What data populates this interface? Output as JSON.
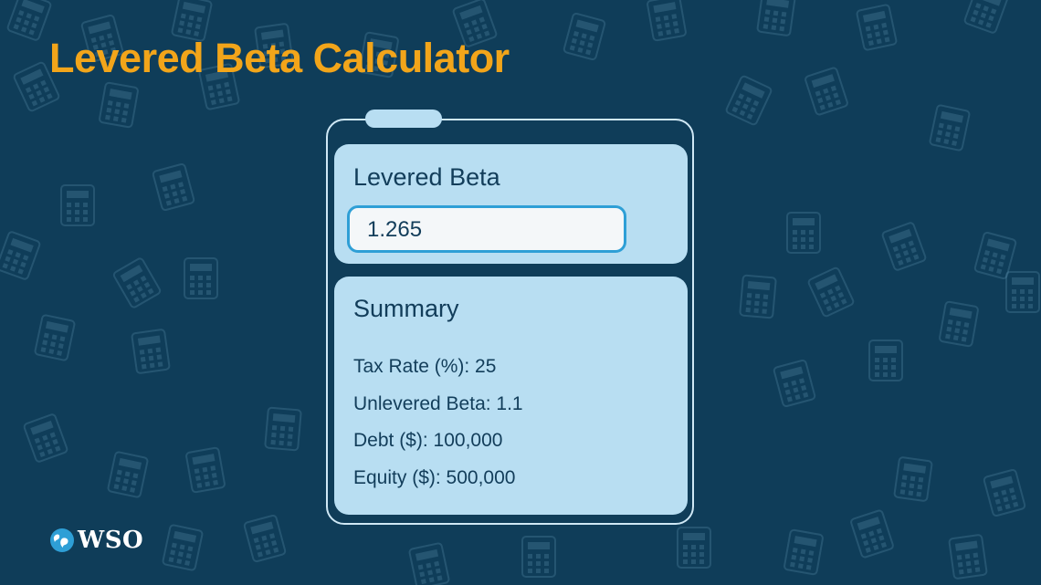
{
  "page": {
    "title": "Levered Beta Calculator",
    "title_color": "#f2a51a",
    "background_color": "#0f3d59"
  },
  "result_card": {
    "heading": "Levered Beta",
    "value": "1.265"
  },
  "summary_card": {
    "heading": "Summary",
    "items": [
      "Tax Rate (%): 25",
      "Unlevered Beta: 1.1",
      "Debt ($): 100,000",
      "Equity ($): 500,000"
    ]
  },
  "brand": {
    "name": "WSO",
    "icon": "globe-logo-icon"
  },
  "background": {
    "icon": "calculator-icon"
  }
}
